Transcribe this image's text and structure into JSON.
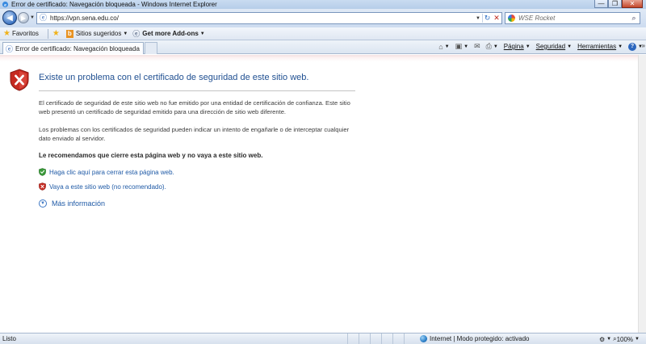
{
  "window": {
    "title": "Error de certificado: Navegación bloqueada - Windows Internet Explorer",
    "minimize": "—",
    "maximize": "❐",
    "close": "✕"
  },
  "nav": {
    "url": "https://vpn.sena.edu.co/",
    "search_placeholder": "WSE Rocket"
  },
  "favorites_bar": {
    "favorites_label": "Favoritos",
    "suggested_sites": "Sitios sugeridos",
    "addons": "Get more Add-ons"
  },
  "tab": {
    "title": "Error de certificado: Navegación bloqueada"
  },
  "command_bar": {
    "page": "Página",
    "safety": "Seguridad",
    "tools": "Herramientas"
  },
  "content": {
    "heading": "Existe un problema con el certificado de seguridad de este sitio web.",
    "paragraph1": "El certificado de seguridad de este sitio web no fue emitido por una entidad de certificación de confianza. Este sitio web presentó un certificado de seguridad emitido para una dirección de sitio web diferente.",
    "paragraph2": "Los problemas con los certificados de seguridad pueden indicar un intento de engañarle o de interceptar cualquier dato enviado al servidor.",
    "recommendation": "Le recomendamos que cierre esta página web y no vaya a este sitio web.",
    "close_link": "Haga clic aquí para cerrar esta página web.",
    "continue_link": "Vaya a este sitio web (no recomendado).",
    "more_info": "Más información"
  },
  "status": {
    "left": "Listo",
    "zone": "Internet | Modo protegido: activado",
    "zoom": "100%"
  },
  "colors": {
    "link": "#1f5aa6",
    "heading": "#1f4f91",
    "danger": "#c62b22",
    "safe": "#3a9a3a"
  }
}
